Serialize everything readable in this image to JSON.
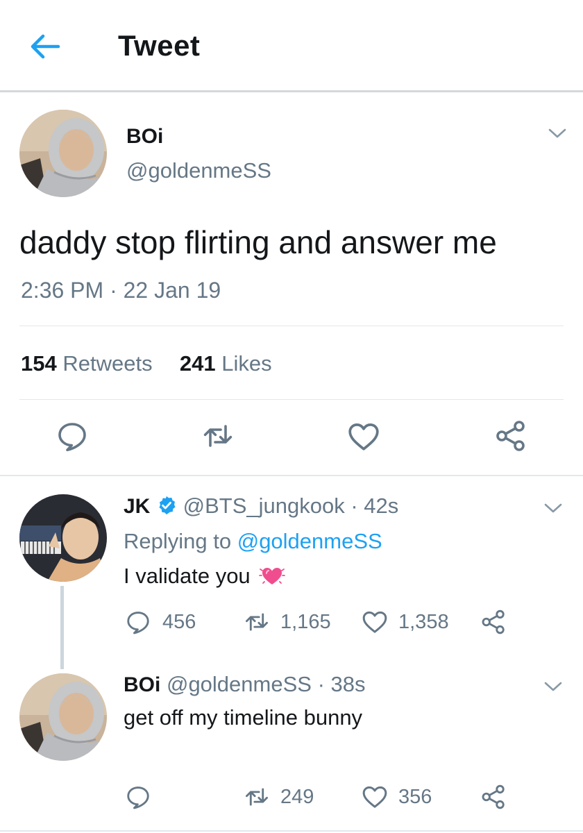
{
  "header": {
    "title": "Tweet"
  },
  "tweet": {
    "author_name": "BOi",
    "author_handle": "@goldenmeSS",
    "text": "daddy stop flirting and answer me",
    "time": "2:36 PM",
    "separator": "·",
    "date": "22 Jan 19",
    "retweets_count": "154",
    "retweets_label": "Retweets",
    "likes_count": "241",
    "likes_label": "Likes"
  },
  "replies": [
    {
      "name": "JK",
      "verified": true,
      "handle": "@BTS_jungkook",
      "separator": "·",
      "age": "42s",
      "replying_label": "Replying to",
      "replying_handle": "@goldenmeSS",
      "text": "I validate you",
      "emoji": "sparkling-heart",
      "reply_count": "456",
      "retweet_count": "1,165",
      "like_count": "1,358"
    },
    {
      "name": "BOi",
      "handle": "@goldenmeSS",
      "separator": "·",
      "age": "38s",
      "text": "get off my timeline bunny",
      "retweet_count": "249",
      "like_count": "356"
    }
  ],
  "colors": {
    "accent": "#1da1f2",
    "muted": "#657786",
    "text": "#14171a",
    "divider": "#e1e8ed",
    "heart_emoji": "#f04d8f"
  },
  "icons": [
    "back-arrow-icon",
    "chevron-down-icon",
    "reply-icon",
    "retweet-icon",
    "like-icon",
    "share-icon",
    "verified-badge-icon"
  ]
}
